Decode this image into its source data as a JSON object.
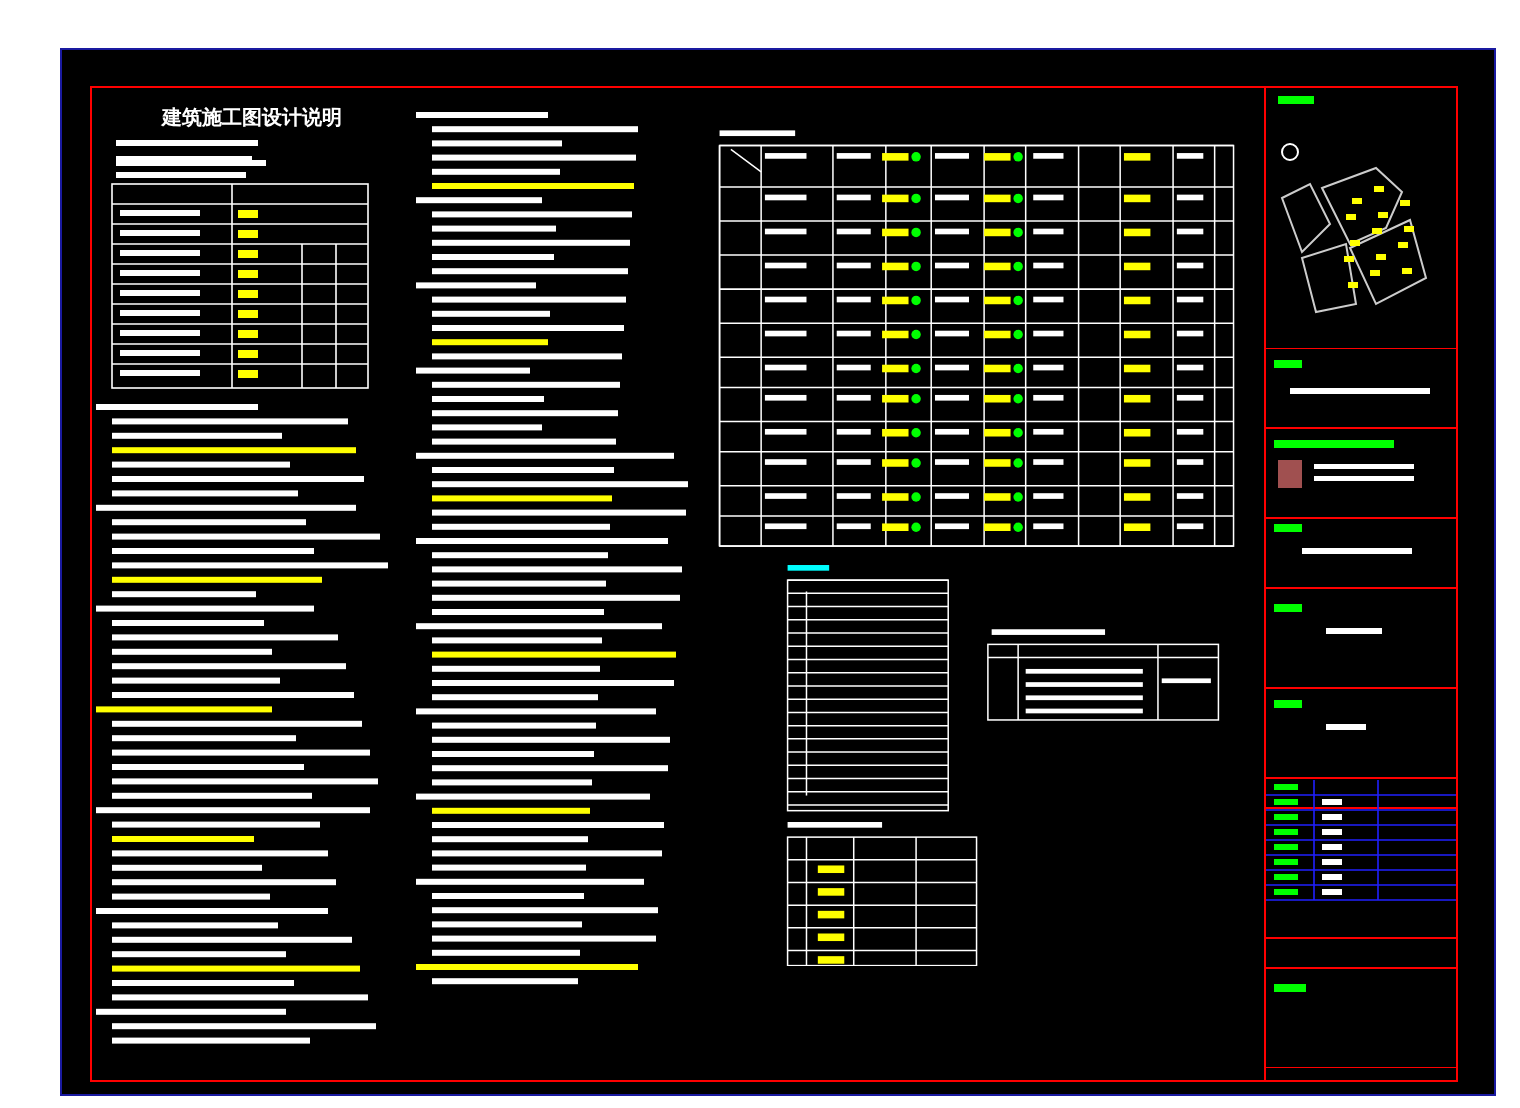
{
  "sheet": {
    "title": "建筑施工图设计说明"
  }
}
